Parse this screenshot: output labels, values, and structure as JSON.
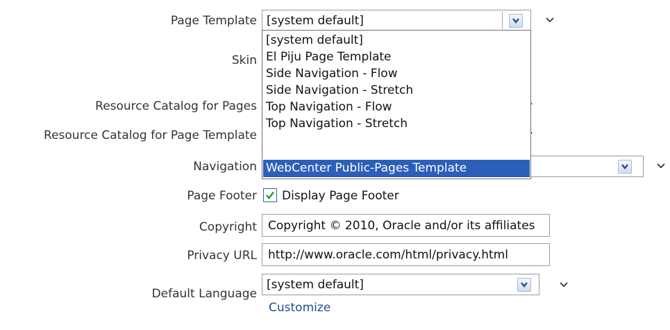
{
  "form": {
    "page_template": {
      "label": "Page Template",
      "value": "[system default]",
      "options": [
        "[system default]",
        "El Piju Page Template",
        "Side Navigation - Flow",
        "Side Navigation - Stretch",
        "Top Navigation - Flow",
        "Top Navigation - Stretch",
        "WebCenter Public-Pages Template"
      ],
      "highlighted_option": "WebCenter Public-Pages Template"
    },
    "skin": {
      "label": "Skin"
    },
    "resource_catalog_pages": {
      "label": "Resource Catalog for Pages"
    },
    "resource_catalog_page_template": {
      "label": "Resource Catalog for Page Template"
    },
    "navigation": {
      "label": "Navigation"
    },
    "page_footer": {
      "label": "Page Footer",
      "checkbox_label": "Display Page Footer",
      "checked": true
    },
    "copyright": {
      "label": "Copyright",
      "value": "Copyright © 2010, Oracle and/or its affiliates"
    },
    "privacy_url": {
      "label": "Privacy URL",
      "value": "http://www.oracle.com/html/privacy.html"
    },
    "default_language": {
      "label": "Default Language",
      "value": "[system default]",
      "customize_link": "Customize"
    }
  },
  "icons": {
    "dropdown_arrow": "chevron-down-icon",
    "checkbox_check": "checkmark-icon"
  },
  "colors": {
    "highlight": "#2c5fb9",
    "link": "#1f4c8c",
    "checkmark": "#2e9e2e"
  }
}
